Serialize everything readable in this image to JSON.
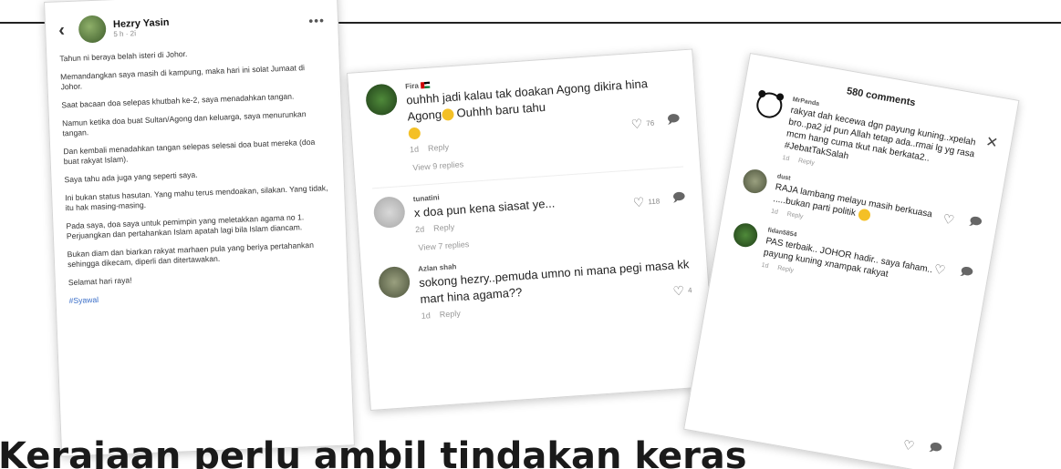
{
  "headline": "Kerajaan perlu ambil tindakan keras",
  "post": {
    "author": "Hezry Yasin",
    "meta": "5 h · 2ⅰ",
    "paragraphs": [
      "Tahun ni beraya belah isteri di Johor.",
      "Memandangkan saya masih di kampung, maka hari ini solat Jumaat di Johor.",
      "Saat bacaan doa selepas khutbah ke-2, saya menadahkan tangan.",
      "Namun ketika doa buat Sultan/Agong dan keluarga, saya menurunkan tangan.",
      "Dan kembali menadahkan tangan selepas selesai doa buat mereka (doa buat rakyat Islam).",
      "Saya tahu ada juga yang seperti saya.",
      "Ini bukan status hasutan. Yang mahu terus mendoakan, silakan. Yang tidak, itu hak masing-masing.",
      "Pada saya, doa saya untuk pemimpin yang meletakkan agama no 1. Perjuangkan dan pertahankan Islam apatah lagi bila Islam diancam.",
      "Bukan diam dan biarkan rakyat marhaen pula yang beriya pertahankan sehingga dikecam, diperli dan ditertawakan.",
      "Selamat hari raya!"
    ],
    "hashtag": "#Syawal"
  },
  "comments_panel": {
    "comments": [
      {
        "user": "Fira",
        "text": "ouhhh jadi kalau tak doakan Agong dikira hina Agong",
        "text2": " Ouhhh baru tahu",
        "time": "1d",
        "reply": "Reply",
        "likes": "76",
        "replies": "View 9 replies"
      },
      {
        "user": "tunatini",
        "text": "x doa pun kena siasat ye...",
        "time": "2d",
        "reply": "Reply",
        "likes": "118",
        "replies": "View 7 replies"
      },
      {
        "user": "Azlan shah",
        "text": "sokong hezry..pemuda umno ni mana pegi masa kk mart hina agama??",
        "time": "1d",
        "reply": "Reply",
        "likes": "4"
      }
    ]
  },
  "tiktok_panel": {
    "title": "580 comments",
    "comments": [
      {
        "user": "MrPanda",
        "text": "rakyat dah kecewa dgn payung kuning..xpelah bro..pa2 jd pun Allah tetap ada..rmai lg yg rasa mcm hang cuma tkut nak berkata2.. #JebatTakSalah",
        "time": "1d",
        "reply": "Reply"
      },
      {
        "user": "dust",
        "text": "RAJA lambang melayu masih berkuasa .....bukan parti politik",
        "time": "1d",
        "reply": "Reply"
      },
      {
        "user": "fidan5854",
        "text": "PAS terbaik.. JOHOR hadir.. saya faham.. payung kuning xnampak rakyat",
        "time": "1d",
        "reply": "Reply"
      }
    ]
  }
}
